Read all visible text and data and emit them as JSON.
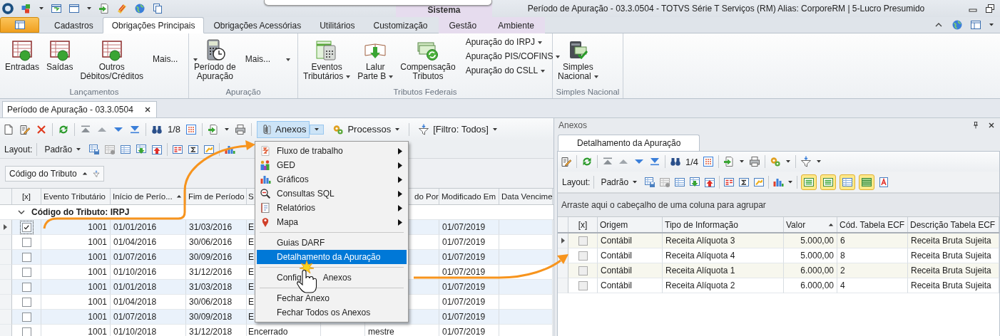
{
  "title_bar": {
    "context_group": "Sistema",
    "title": "Período de Apuração - 03.3.0504 - TOTVS Série T Serviços (RM) Alias: CorporeRM | 5-Lucro Presumido"
  },
  "ribbon": {
    "tabs": [
      {
        "label": "Cadastros",
        "selected": false,
        "contextual": false
      },
      {
        "label": "Obrigações Principais",
        "selected": true,
        "contextual": false
      },
      {
        "label": "Obrigações Acessórias",
        "selected": false,
        "contextual": false
      },
      {
        "label": "Utilitários",
        "selected": false,
        "contextual": false
      },
      {
        "label": "Customização",
        "selected": false,
        "contextual": false
      },
      {
        "label": "Gestão",
        "selected": false,
        "contextual": true
      },
      {
        "label": "Ambiente",
        "selected": false,
        "contextual": true
      }
    ],
    "groups": [
      {
        "label": "Lançamentos",
        "buttons": [
          {
            "kind": "large",
            "label": "Entradas",
            "dropdown": false
          },
          {
            "kind": "large",
            "label": "Saídas",
            "dropdown": false
          },
          {
            "kind": "large",
            "label": "Outros\nDébitos/Créditos",
            "dropdown": false
          },
          {
            "kind": "more",
            "label": "Mais..."
          }
        ]
      },
      {
        "label": "Apuração",
        "buttons": [
          {
            "kind": "large",
            "label": "Período de\nApuração",
            "dropdown": false
          },
          {
            "kind": "more",
            "label": "Mais..."
          }
        ]
      },
      {
        "label": "Tributos Federais",
        "buttons": [
          {
            "kind": "large",
            "label": "Eventos\nTributários",
            "dropdown": true
          },
          {
            "kind": "large",
            "label": "Lalur\nParte B",
            "dropdown": true
          },
          {
            "kind": "large",
            "label": "Compensação\nTributos",
            "dropdown": false
          },
          {
            "kind": "small",
            "items": [
              "Apuração do IRPJ",
              "Apuração PIS/COFINS",
              "Apuração do CSLL"
            ]
          }
        ]
      },
      {
        "label": "Simples Nacional",
        "buttons": [
          {
            "kind": "large",
            "label": "Simples\nNacional",
            "dropdown": true
          }
        ]
      }
    ]
  },
  "document_tab": {
    "label": "Período de Apuração - 03.3.0504"
  },
  "main_grid": {
    "toolbar": {
      "counter": "1/8",
      "attachments_button": {
        "label": "Anexos",
        "pressed": true
      },
      "processes_button": "Processos",
      "filter_button": "[Filtro: Todos]"
    },
    "layout_bar": {
      "label": "Layout:",
      "preset": "Padrão"
    },
    "group_chip": "Código do Tributo",
    "columns": [
      {
        "label": "[x]"
      },
      {
        "label": "Evento Tributário"
      },
      {
        "label": "Início de Perío...",
        "sorted": true
      },
      {
        "label": "Fim de Período"
      },
      {
        "label": "S"
      },
      {},
      {
        "label": "do Por"
      },
      {
        "label": "Modificado Em"
      },
      {
        "label": "Data Vencime"
      }
    ],
    "group_row": "Código do Tributo: IRPJ",
    "rows": [
      {
        "selected": true,
        "checked": true,
        "cells": [
          null,
          "1001",
          "01/01/2016",
          "31/03/2016",
          "E",
          null,
          null,
          "01/07/2019",
          null
        ]
      },
      {
        "selected": false,
        "checked": false,
        "cells": [
          null,
          "1001",
          "01/04/2016",
          "30/06/2016",
          "E",
          null,
          null,
          "01/07/2019",
          null
        ]
      },
      {
        "selected": false,
        "checked": false,
        "cells": [
          null,
          "1001",
          "01/07/2016",
          "30/09/2016",
          "E",
          null,
          null,
          "01/07/2019",
          null
        ]
      },
      {
        "selected": false,
        "checked": false,
        "cells": [
          null,
          "1001",
          "01/10/2016",
          "31/12/2016",
          "E",
          null,
          null,
          "01/07/2019",
          null
        ]
      },
      {
        "selected": false,
        "checked": false,
        "cells": [
          null,
          "1001",
          "01/01/2018",
          "31/03/2018",
          "E",
          null,
          null,
          "01/07/2019",
          null
        ]
      },
      {
        "selected": false,
        "checked": false,
        "cells": [
          null,
          "1001",
          "01/04/2018",
          "30/06/2018",
          "E",
          null,
          null,
          "01/07/2019",
          null
        ]
      },
      {
        "selected": false,
        "checked": false,
        "cells": [
          null,
          "1001",
          "01/07/2018",
          "30/09/2018",
          "E",
          null,
          null,
          "01/07/2019",
          null
        ]
      },
      {
        "selected": false,
        "checked": false,
        "cells": [
          null,
          "1001",
          "01/10/2018",
          "31/12/2018",
          "Encerrado",
          null,
          "mestre",
          "01/07/2019",
          null
        ]
      }
    ]
  },
  "attachments_menu": {
    "items": [
      {
        "kind": "submenu",
        "label": "Fluxo de trabalho",
        "selected": false
      },
      {
        "kind": "submenu",
        "label": "GED",
        "selected": false
      },
      {
        "kind": "submenu",
        "label": "Gráficos",
        "selected": false
      },
      {
        "kind": "submenu",
        "label": "Consultas SQL",
        "selected": false
      },
      {
        "kind": "submenu",
        "label": "Relatórios",
        "selected": false
      },
      {
        "kind": "submenu",
        "label": "Mapa",
        "selected": false
      },
      {
        "kind": "separator"
      },
      {
        "kind": "action",
        "label": "Guias DARF",
        "selected": false
      },
      {
        "kind": "action",
        "label": "Detalhamento da Apuração",
        "selected": true
      },
      {
        "kind": "separator"
      },
      {
        "kind": "action",
        "label": "Config",
        "label_after_cursor": "Anexos",
        "selected": false
      },
      {
        "kind": "separator"
      },
      {
        "kind": "action",
        "label": "Fechar Anexo",
        "selected": false
      },
      {
        "kind": "action",
        "label": "Fechar Todos os Anexos",
        "selected": false
      }
    ]
  },
  "attachments_panel": {
    "title": "Anexos",
    "tab": "Detalhamento da Apuração",
    "toolbar": {
      "counter": "1/4"
    },
    "layout_bar": {
      "label": "Layout:",
      "preset": "Padrão"
    },
    "view_toggles": [
      {
        "on": true
      },
      {
        "on": true
      },
      {
        "on": true
      },
      {
        "on": true
      }
    ],
    "group_hint": "Arraste aqui o cabeçalho de uma coluna para agrupar",
    "columns": [
      {
        "label": "[x]"
      },
      {
        "label": "Origem"
      },
      {
        "label": "Tipo de Informação"
      },
      {
        "label": "Valor",
        "sorted": true
      },
      {
        "label": "Cód. Tabela ECF"
      },
      {
        "label": "Descrição Tabela ECF"
      }
    ],
    "rows": [
      {
        "selected": true,
        "checked": false,
        "cells": [
          null,
          "Contábil",
          "Receita Alíquota 3",
          "5.000,00",
          "6",
          "Receita Bruta Sujeita"
        ]
      },
      {
        "selected": false,
        "checked": false,
        "cells": [
          null,
          "Contábil",
          "Receita Alíquota 4",
          "5.000,00",
          "8",
          "Receita Bruta Sujeita"
        ]
      },
      {
        "selected": false,
        "checked": false,
        "cells": [
          null,
          "Contábil",
          "Receita Alíquota 1",
          "6.000,00",
          "2",
          "Receita Bruta Sujeita"
        ]
      },
      {
        "selected": false,
        "checked": false,
        "cells": [
          null,
          "Contábil",
          "Receita Alíquota 2",
          "6.000,00",
          "4",
          "Receita Bruta Sujeita"
        ]
      }
    ]
  }
}
